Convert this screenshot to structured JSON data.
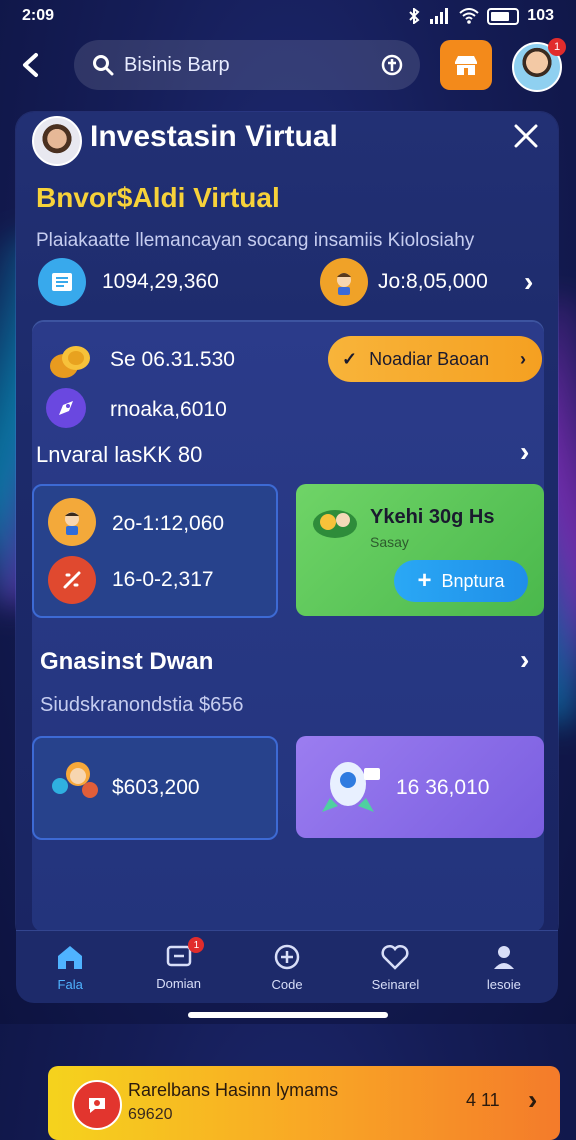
{
  "status_bar": {
    "time": "2:09",
    "battery": "103"
  },
  "search": {
    "placeholder": "Bisinis Barp"
  },
  "avatar_badge": "1",
  "panel": {
    "title": "Investasin Virtual",
    "section_title": "Bnvor$Aldi Virtual",
    "subtitle": "Plaiakaatte llemancayan socang insamiis Kiolosiahy",
    "stat_left_value": "1094,29,360",
    "stat_right_value": "Jo:8,05,000"
  },
  "wallet": {
    "coins_value": "Se 06.31.530",
    "rocket_value": "rnoaka,6010",
    "cta_label": "Noadiar Baoan",
    "section_label": "Lnvaral lasKK 80"
  },
  "cards": {
    "blue1_value1": "2o-1:12,060",
    "blue1_value2": "16-0-2,317",
    "green_title": "Ykehi 30g Hs",
    "green_sub": "Sasay",
    "green_button": "Bnptura"
  },
  "section2": {
    "title": "Gnasinst Dwan",
    "subtitle": "Siudskranondstia $656",
    "blue_value": "$603,200",
    "purple_value": "16 36,010"
  },
  "banner": {
    "title": "Rarelbans Hasinn lymams",
    "subtitle": "69620",
    "right_value": "4 11"
  },
  "bottom_nav": {
    "items": [
      {
        "label": "Fala"
      },
      {
        "label": "Domian"
      },
      {
        "label": "Code"
      },
      {
        "label": "Seinarel"
      },
      {
        "label": "lesoie"
      }
    ],
    "badge": "1"
  },
  "colors": {
    "accent_yellow": "#f7d23a",
    "orange": "#f38a1b",
    "active_blue": "#4fb3ff"
  }
}
